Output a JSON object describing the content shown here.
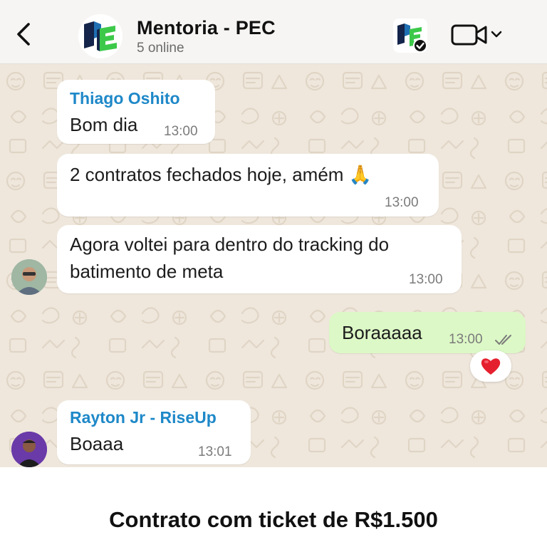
{
  "header": {
    "title": "Mentoria - PEC",
    "subtitle": "5 online",
    "back_icon": "chevron-left-icon",
    "video_icon": "video-camera-icon"
  },
  "messages": [
    {
      "sender": "Thiago Oshito",
      "text": "Bom dia",
      "time": "13:00"
    },
    {
      "text": "2 contratos fechados hoje, amém 🙏",
      "time": "13:00"
    },
    {
      "text_line1": "Agora voltei para dentro do tracking do",
      "text_line2": "batimento de meta",
      "time": "13:00"
    },
    {
      "text": "Boraaaaa",
      "time": "13:00",
      "outgoing": true,
      "reaction": "❤️"
    },
    {
      "sender": "Rayton Jr - RiseUp",
      "text": "Boaaa",
      "time": "13:01"
    }
  ],
  "caption": "Contrato com ticket de R$1.500",
  "colors": {
    "sender_name": "#1e88c8",
    "outgoing_bubble": "#dcf8c6",
    "chat_bg": "#efe7dc",
    "read_ticks": "#7b7b7b",
    "logo_green": "#3cc94a",
    "logo_blue": "#1f6fb3",
    "logo_navy": "#14244a"
  }
}
